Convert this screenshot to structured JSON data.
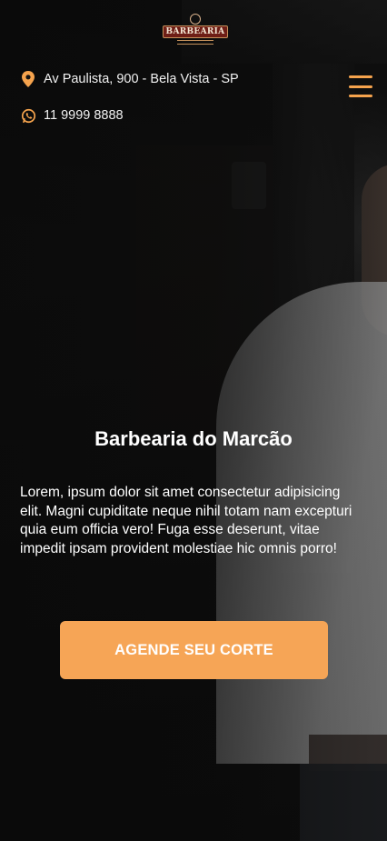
{
  "header": {
    "logo_text": "BARBEARIA",
    "address": "Av Paulista, 900 - Bela Vista - SP",
    "phone": "11 9999 8888",
    "address_icon": "location-pin-icon",
    "phone_icon": "whatsapp-icon",
    "menu_icon": "hamburger-menu-icon"
  },
  "hero": {
    "title": "Barbearia do Marcão",
    "text": "Lorem, ipsum dolor sit amet consectetur adipisicing elit. Magni cupiditate neque nihil totam nam excepturi quia eum officia vero! Fuga esse deserunt, vitae impedit ipsam provident molestiae hic omnis porro!",
    "cta_label": "AGENDE SEU CORTE"
  },
  "colors": {
    "accent": "#f6a556",
    "icon": "#f5a34d",
    "background": "#0c0c0d",
    "text": "#ffffff"
  }
}
